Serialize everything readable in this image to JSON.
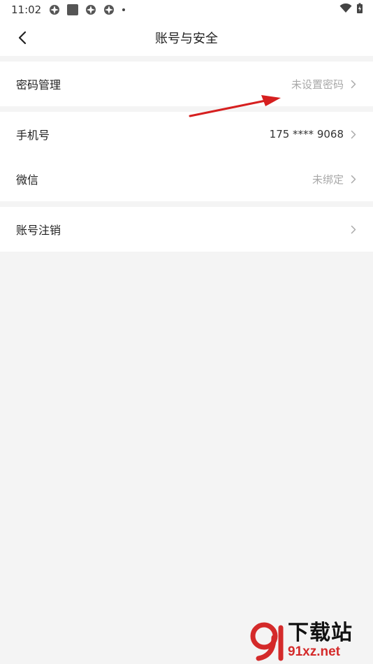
{
  "status_bar": {
    "time": "11:02"
  },
  "nav": {
    "title": "账号与安全"
  },
  "groups": [
    {
      "rows": [
        {
          "label": "密码管理",
          "value": "未设置密码"
        }
      ]
    },
    {
      "rows": [
        {
          "label": "手机号",
          "value": "175 **** 9068"
        },
        {
          "label": "微信",
          "value": "未绑定"
        }
      ]
    },
    {
      "rows": [
        {
          "label": "账号注销",
          "value": ""
        }
      ]
    }
  ],
  "annotation": {
    "arrow_color": "#d61f1f"
  },
  "watermark": {
    "cn": "下载站",
    "en": "91xz.net",
    "brand_color": "#d42a2a"
  }
}
